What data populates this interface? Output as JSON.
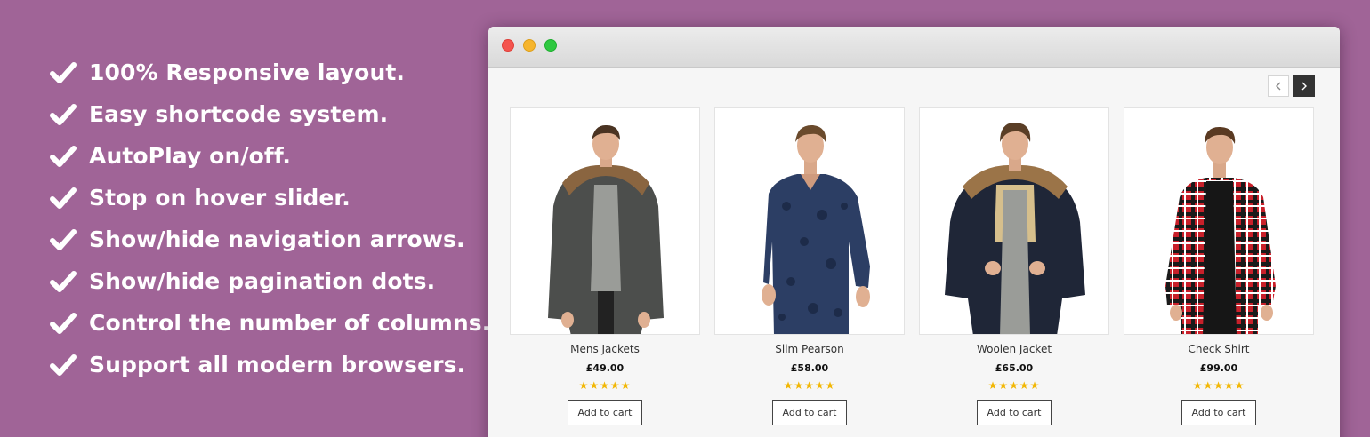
{
  "features": [
    "100% Responsive layout.",
    "Easy shortcode system.",
    "AutoPlay on/off.",
    "Stop on hover slider.",
    "Show/hide navigation arrows.",
    "Show/hide pagination dots.",
    "Control the number of columns.",
    "Support all modern browsers."
  ],
  "colors": {
    "background": "#a06497",
    "checkmark": "#ffffff",
    "star": "#f2b705"
  },
  "slider": {
    "prev_icon": "chevron-left-icon",
    "next_icon": "chevron-right-icon"
  },
  "products": [
    {
      "name": "Mens Jackets",
      "price": "£49.00",
      "rating": "★★★★★",
      "button": "Add to cart"
    },
    {
      "name": "Slim Pearson",
      "price": "£58.00",
      "rating": "★★★★★",
      "button": "Add to cart"
    },
    {
      "name": "Woolen Jacket",
      "price": "£65.00",
      "rating": "★★★★★",
      "button": "Add to cart"
    },
    {
      "name": "Check Shirt",
      "price": "£99.00",
      "rating": "★★★★★",
      "button": "Add to cart"
    }
  ]
}
